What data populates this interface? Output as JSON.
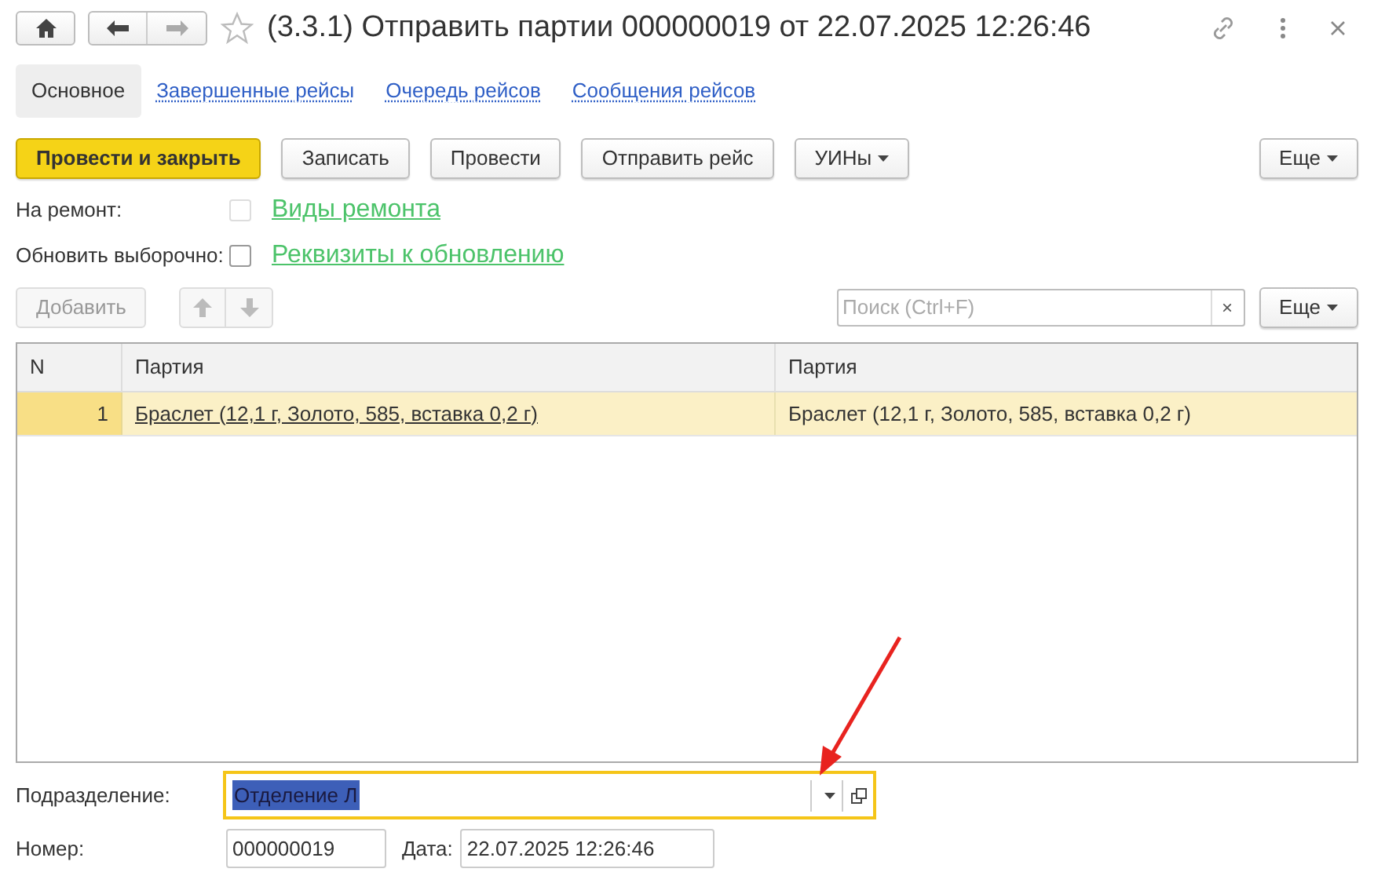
{
  "window": {
    "title": "(3.3.1) Отправить партии 000000019 от 22.07.2025 12:26:46"
  },
  "tabs": [
    {
      "label": "Основное",
      "selected": true
    },
    {
      "label": "Завершенные рейсы",
      "selected": false
    },
    {
      "label": "Очередь рейсов",
      "selected": false
    },
    {
      "label": "Сообщения рейсов",
      "selected": false
    }
  ],
  "commands": [
    {
      "label": "Провести и закрыть",
      "kind": "primary"
    },
    {
      "label": "Записать",
      "kind": "plain"
    },
    {
      "label": "Провести",
      "kind": "plain"
    },
    {
      "label": "Отправить рейс",
      "kind": "plain"
    },
    {
      "label": "УИНы",
      "kind": "dropdown"
    }
  ],
  "more_button": "Еще",
  "options": [
    {
      "label": "На ремонт:",
      "checked": false,
      "disabled": true,
      "link": "Виды ремонта"
    },
    {
      "label": "Обновить выборочно:",
      "checked": false,
      "disabled": false,
      "link": "Реквизиты к обновлению"
    }
  ],
  "table_toolbar": {
    "add_button": "Добавить",
    "add_disabled": true,
    "search": {
      "placeholder": "Поиск (Ctrl+F)"
    },
    "clear": "×",
    "more_button": "Еще"
  },
  "table": {
    "columns": [
      "N",
      "Партия",
      "Партия"
    ],
    "rows": [
      {
        "cells": [
          "1",
          "Браслет (12,1 г, Золото, 585, вставка 0,2 г)",
          "Браслет (12,1 г, Золото, 585, вставка 0,2 г)"
        ],
        "selected": true
      }
    ]
  },
  "department": {
    "label": "Подразделение:",
    "value": "Отделение Л"
  },
  "number": {
    "label": "Номер:",
    "value": "000000019"
  },
  "date": {
    "label": "Дата:",
    "value": "22.07.2025 12:26:46"
  }
}
